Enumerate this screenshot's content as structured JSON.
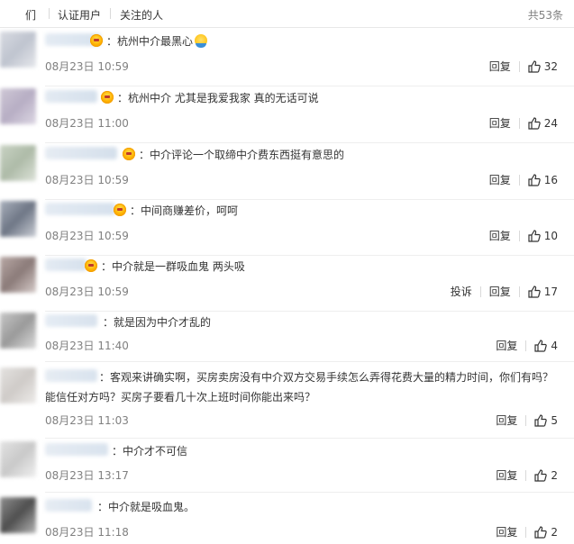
{
  "tabs": {
    "partial": "们",
    "verified": "认证用户",
    "following": "关注的人"
  },
  "total": "共53条",
  "actions": {
    "reply": "回复",
    "report": "投诉"
  },
  "colors": {
    "link": "#333333",
    "meta": "#808080",
    "vip": "#ffb100",
    "divider": "#eeeeee"
  },
  "comments": [
    {
      "text": "：杭州中介最黑心",
      "time": "08月23日 10:59",
      "likes": "32",
      "emoji": "emoji-face"
    },
    {
      "text": "：杭州中介 尤其是我爱我家 真的无话可说",
      "time": "08月23日 11:00",
      "likes": "24"
    },
    {
      "text": "：中介评论一个取缔中介费东西挺有意思的",
      "time": "08月23日 10:59",
      "likes": "16"
    },
    {
      "text": "：中间商赚差价，呵呵",
      "time": "08月23日 10:59",
      "likes": "10"
    },
    {
      "text": "：中介就是一群吸血鬼 两头吸",
      "time": "08月23日 10:59",
      "likes": "17",
      "report": true
    },
    {
      "text": "：就是因为中介才乱的",
      "time": "08月23日 11:40",
      "likes": "4"
    },
    {
      "text": "：客观来讲确实啊，买房卖房没有中介双方交易手续怎么弄得花费大量的精力时间，你们有吗？能信任对方吗？买房子要看几十次上班时间你能出来吗？",
      "time": "08月23日 11:03",
      "likes": "5"
    },
    {
      "text": "：中介才不可信",
      "time": "08月23日 13:17",
      "likes": "2"
    },
    {
      "text": "：中介就是吸血鬼。",
      "time": "08月23日 11:18",
      "likes": "2"
    }
  ]
}
